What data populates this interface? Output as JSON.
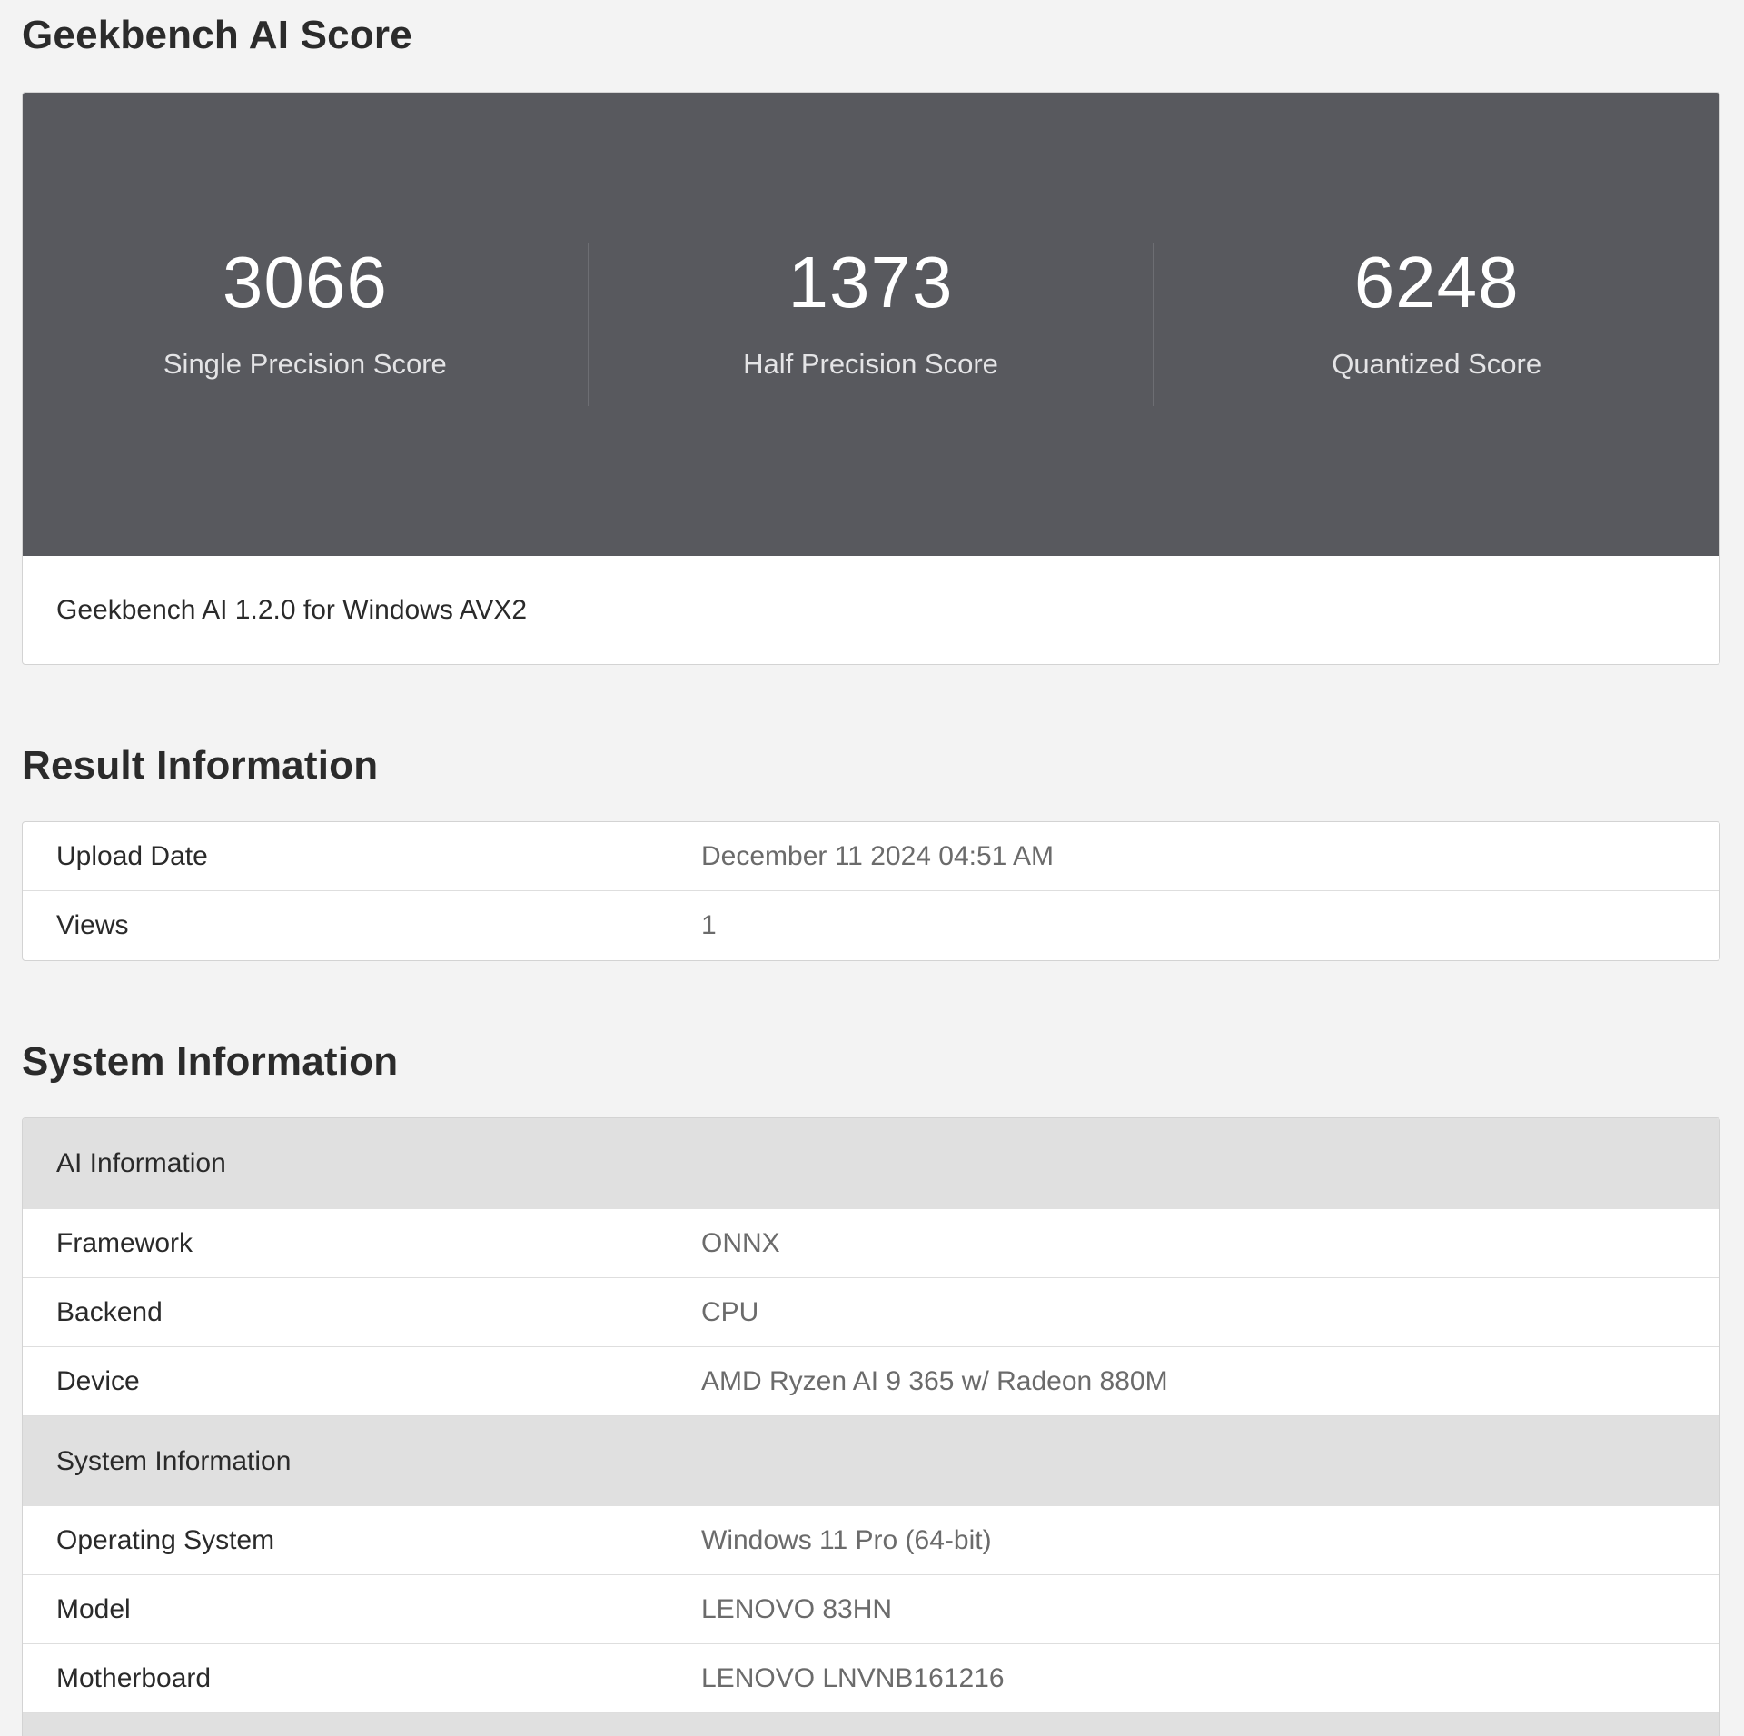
{
  "score_section": {
    "title": "Geekbench AI Score",
    "scores": [
      {
        "value": "3066",
        "label": "Single Precision Score"
      },
      {
        "value": "1373",
        "label": "Half Precision Score"
      },
      {
        "value": "6248",
        "label": "Quantized Score"
      }
    ],
    "version": "Geekbench AI 1.2.0 for Windows AVX2"
  },
  "result_section": {
    "title": "Result Information",
    "rows": [
      {
        "key": "Upload Date",
        "value": "December 11 2024 04:51 AM"
      },
      {
        "key": "Views",
        "value": "1"
      }
    ]
  },
  "system_section": {
    "title": "System Information",
    "groups": [
      {
        "header": "AI Information",
        "rows": [
          {
            "key": "Framework",
            "value": "ONNX"
          },
          {
            "key": "Backend",
            "value": "CPU"
          },
          {
            "key": "Device",
            "value": "AMD Ryzen AI 9 365 w/ Radeon 880M"
          }
        ]
      },
      {
        "header": "System Information",
        "rows": [
          {
            "key": "Operating System",
            "value": "Windows 11 Pro (64-bit)"
          },
          {
            "key": "Model",
            "value": "LENOVO 83HN"
          },
          {
            "key": "Motherboard",
            "value": "LENOVO LNVNB161216"
          }
        ]
      }
    ]
  }
}
